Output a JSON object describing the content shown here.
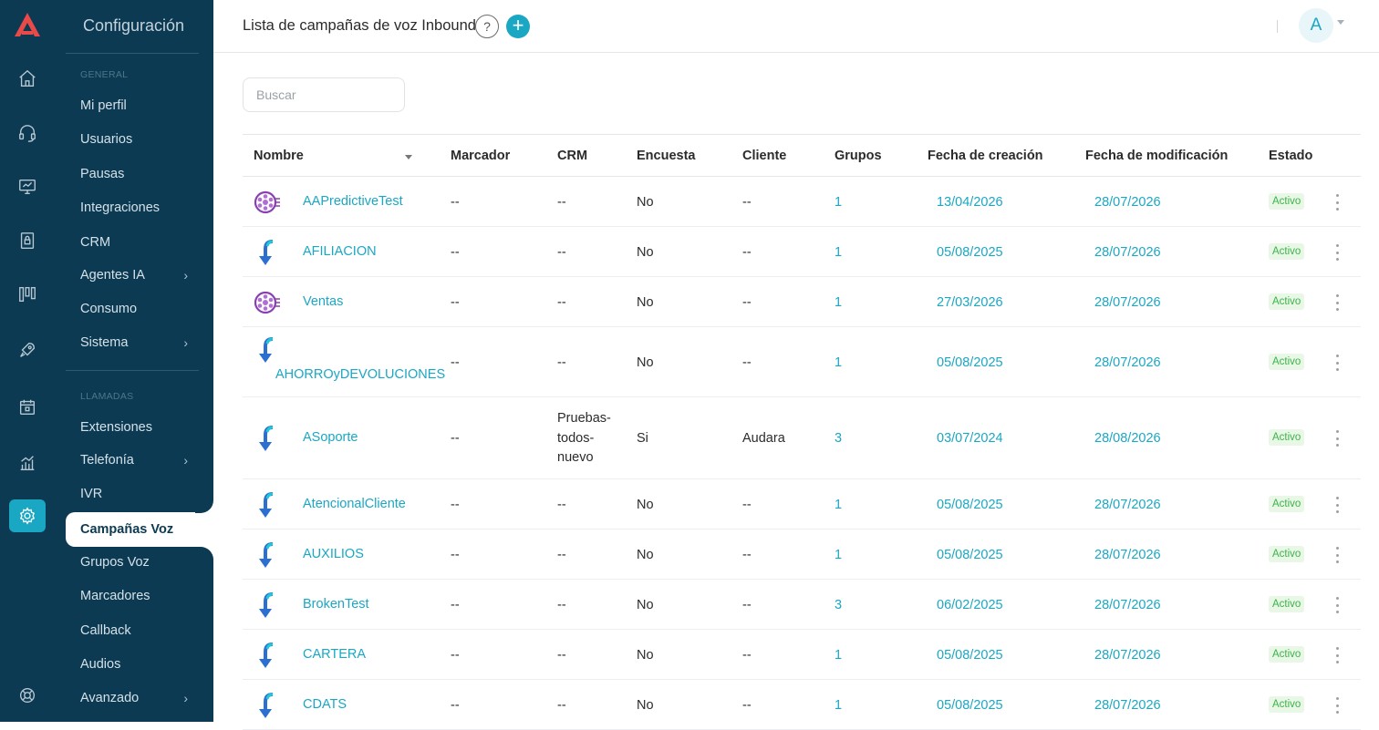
{
  "brand": {
    "accent": "#1aa7c4",
    "sidebar_bg": "#0b3a52",
    "logo_color": "#e84a4a"
  },
  "rail": {
    "icons": [
      "home-icon",
      "headset-icon",
      "monitor-icon",
      "lock-panel-icon",
      "columns-icon",
      "rocket-icon",
      "calendar-icon",
      "bar-chart-icon",
      "gear-icon",
      "lifebuoy-icon"
    ],
    "active": "gear-icon"
  },
  "sidebar": {
    "title": "Configuración",
    "section_general": "GENERAL",
    "section_calls": "LLAMADAS",
    "items": [
      {
        "label": "Mi perfil"
      },
      {
        "label": "Usuarios"
      },
      {
        "label": "Pausas"
      },
      {
        "label": "Integraciones"
      },
      {
        "label": "CRM"
      },
      {
        "label": "Agentes IA",
        "chevron": "›"
      },
      {
        "label": "Consumo"
      },
      {
        "label": "Sistema",
        "chevron": "›"
      },
      {
        "label": "Extensiones"
      },
      {
        "label": "Telefonía",
        "chevron": "›"
      },
      {
        "label": "IVR"
      },
      {
        "label": "Campañas Voz"
      },
      {
        "label": "Grupos Voz"
      },
      {
        "label": "Marcadores"
      },
      {
        "label": "Callback"
      },
      {
        "label": "Audios"
      },
      {
        "label": "Avanzado",
        "chevron": "›"
      }
    ]
  },
  "header": {
    "title": "Lista de campañas de voz Inbound",
    "help": "?",
    "add": "+",
    "avatar": "A"
  },
  "search": {
    "placeholder": "Buscar"
  },
  "table": {
    "columns": [
      "Nombre",
      "Marcador",
      "CRM",
      "Encuesta",
      "Cliente",
      "Grupos",
      "Fecha de creación",
      "Fecha de modificación",
      "Estado"
    ],
    "rows": [
      {
        "icon": "predictive-icon",
        "name": "AAPredictiveTest",
        "marcador": "--",
        "crm": "--",
        "encuesta": "No",
        "cliente": "--",
        "grupos": "1",
        "creacion": "13/04/2026",
        "modificacion": "28/07/2026",
        "estado": "Activo"
      },
      {
        "icon": "inbound-arrow-icon",
        "name": "AFILIACION",
        "marcador": "--",
        "crm": "--",
        "encuesta": "No",
        "cliente": "--",
        "grupos": "1",
        "creacion": "05/08/2025",
        "modificacion": "28/07/2026",
        "estado": "Activo"
      },
      {
        "icon": "predictive-icon",
        "name": "Ventas",
        "marcador": "--",
        "crm": "--",
        "encuesta": "No",
        "cliente": "--",
        "grupos": "1",
        "creacion": "27/03/2026",
        "modificacion": "28/07/2026",
        "estado": "Activo"
      },
      {
        "icon": "inbound-arrow-icon",
        "name": "AHORROyDEVOLUCIONES",
        "marcador": "--",
        "crm": "--",
        "encuesta": "No",
        "cliente": "--",
        "grupos": "1",
        "creacion": "05/08/2025",
        "modificacion": "28/07/2026",
        "estado": "Activo"
      },
      {
        "icon": "inbound-arrow-icon",
        "name": "ASoporte",
        "marcador": "--",
        "crm": "Pruebas-todos-nuevo",
        "crm_lines": [
          "Pruebas-",
          "todos-",
          "nuevo"
        ],
        "encuesta": "Si",
        "cliente": "Audara",
        "grupos": "3",
        "creacion": "03/07/2024",
        "modificacion": "28/08/2026",
        "estado": "Activo"
      },
      {
        "icon": "inbound-arrow-icon",
        "name": "AtencionalCliente",
        "marcador": "--",
        "crm": "--",
        "encuesta": "No",
        "cliente": "--",
        "grupos": "1",
        "creacion": "05/08/2025",
        "modificacion": "28/07/2026",
        "estado": "Activo"
      },
      {
        "icon": "inbound-arrow-icon",
        "name": "AUXILIOS",
        "marcador": "--",
        "crm": "--",
        "encuesta": "No",
        "cliente": "--",
        "grupos": "1",
        "creacion": "05/08/2025",
        "modificacion": "28/07/2026",
        "estado": "Activo"
      },
      {
        "icon": "inbound-arrow-icon",
        "name": "BrokenTest",
        "marcador": "--",
        "crm": "--",
        "encuesta": "No",
        "cliente": "--",
        "grupos": "3",
        "creacion": "06/02/2025",
        "modificacion": "28/07/2026",
        "estado": "Activo"
      },
      {
        "icon": "inbound-arrow-icon",
        "name": "CARTERA",
        "marcador": "--",
        "crm": "--",
        "encuesta": "No",
        "cliente": "--",
        "grupos": "1",
        "creacion": "05/08/2025",
        "modificacion": "28/07/2026",
        "estado": "Activo"
      },
      {
        "icon": "inbound-arrow-icon",
        "name": "CDATS",
        "marcador": "--",
        "crm": "--",
        "encuesta": "No",
        "cliente": "--",
        "grupos": "1",
        "creacion": "05/08/2025",
        "modificacion": "28/07/2026",
        "estado": "Activo"
      }
    ]
  }
}
